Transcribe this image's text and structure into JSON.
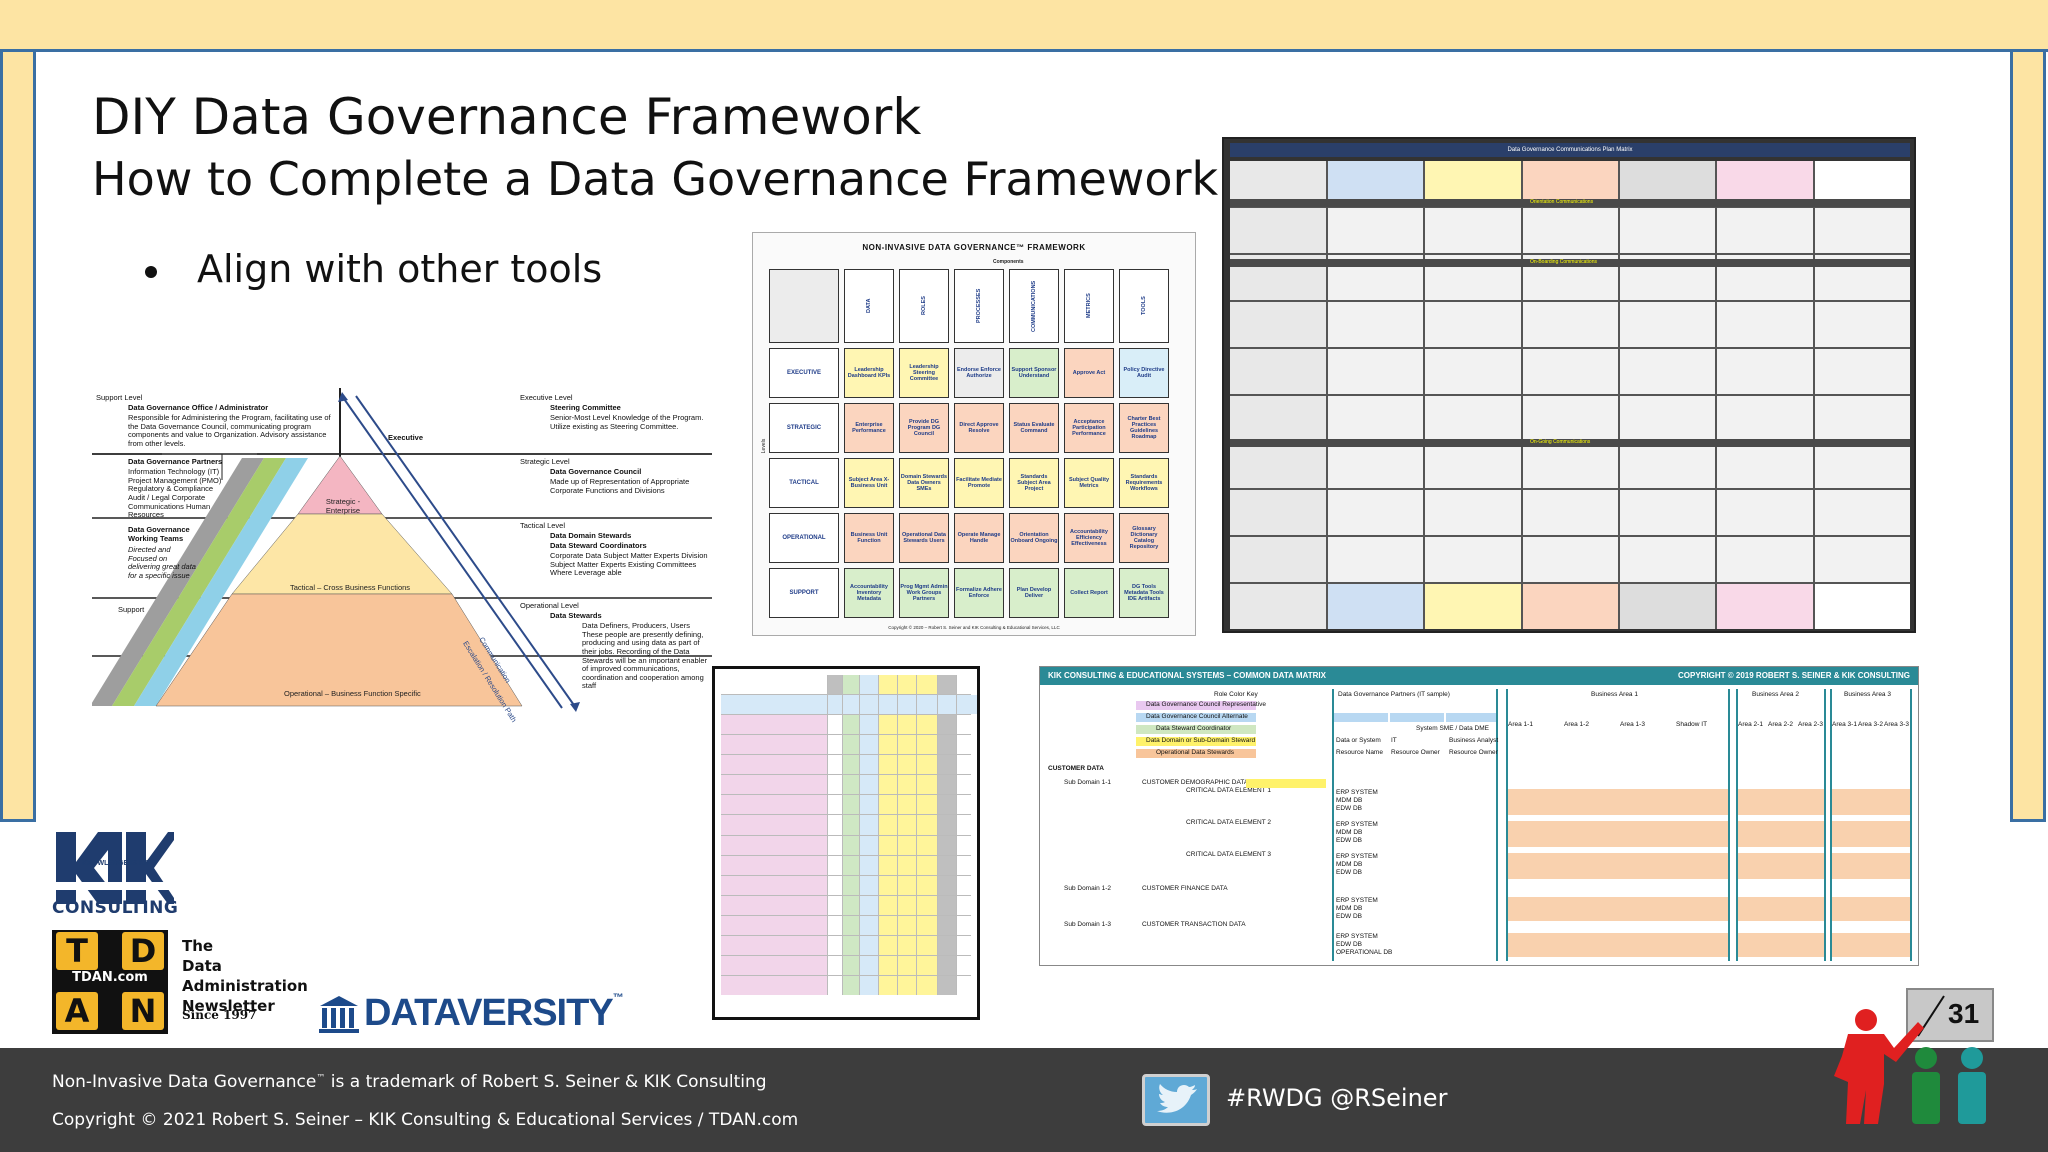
{
  "slide": {
    "title": "DIY Data Governance Framework",
    "subtitle": "How to Complete a Data Governance Framework",
    "bullet": "Align with other tools",
    "page_number": "31"
  },
  "pyramid": {
    "support_level": "Support Level",
    "dgo": "Data Governance Office / Administrator",
    "dgo_desc": "Responsible for Administering the Program, facilitating use of the Data Governance Council, communicating program components and value to Organization. Advisory assistance from other levels.",
    "partners": "Data Governance Partners",
    "partners_desc": "Information Technology (IT) Project Management (PMO) Regulatory & Compliance Audit / Legal Corporate Communications Human Resources",
    "working_teams": "Data Governance Working Teams",
    "working_desc": "Directed and Focused on delivering great data for a specific issue",
    "support": "Support",
    "executive": "Executive",
    "exec_level": "Executive Level",
    "steering": "Steering Committee",
    "steering_desc": "Senior-Most Level Knowledge of the Program. Utilize existing as Steering Committee.",
    "strategic_level": "Strategic Level",
    "council": "Data Governance Council",
    "council_desc": "Made up of Representation of Appropriate Corporate Functions and Divisions",
    "tactical_level": "Tactical Level",
    "domain": "Data Domain Stewards",
    "coord": "Data Steward Coordinators",
    "tactical_desc": "Corporate Data Subject Matter Experts Division Subject Matter Experts Existing Committees Where Leverage able",
    "operational_level": "Operational Level",
    "stewards": "Data Stewards",
    "stewards_desc": "Data Definers, Producers, Users These people are presently defining, producing and using data as part of their jobs. Recording of the Data Stewards will be an important enabler of improved communications, coordination and cooperation among staff",
    "strategic_band": "Strategic - Enterprise",
    "tactical_band": "Tactical – Cross Business Functions",
    "operational_band": "Operational – Business Function Specific",
    "comm_arrow": "Communication",
    "esc_arrow": "Escalation / Resolution Path"
  },
  "nidg": {
    "title": "NON-INVASIVE DATA GOVERNANCE™ FRAMEWORK",
    "components": "Components",
    "levels": "Levels",
    "columns": [
      "DATA",
      "ROLES",
      "PROCESSES",
      "COMMUNICATIONS",
      "METRICS",
      "TOOLS"
    ],
    "rows": [
      {
        "label": "EXECUTIVE",
        "cells": [
          "Leadership Dashboard KPIs",
          "Leadership Steering Committee",
          "Endorse Enforce Authorize",
          "Support Sponsor Understand",
          "Approve Act",
          "Policy Directive Audit"
        ]
      },
      {
        "label": "STRATEGIC",
        "cells": [
          "Enterprise Performance",
          "Provide DG Program DG Council",
          "Direct Approve Resolve",
          "Status Evaluate Command",
          "Acceptance Participation Performance",
          "Charter Best Practices Guidelines Roadmap"
        ]
      },
      {
        "label": "TACTICAL",
        "cells": [
          "Subject Area X-Business Unit",
          "Domain Stewards Data Owners SMEs",
          "Facilitate Mediate Promote",
          "Standards Subject Area Project",
          "Subject Quality Metrics",
          "Standards Requirements Workflows"
        ]
      },
      {
        "label": "OPERATIONAL",
        "cells": [
          "Business Unit Function",
          "Operational Data Stewards Users",
          "Operate Manage Handle",
          "Orientation Onboard Ongoing",
          "Accountability Efficiency Effectiveness",
          "Glossary Dictionary Catalog Repository"
        ]
      },
      {
        "label": "SUPPORT",
        "cells": [
          "Accountability Inventory Metadata",
          "Prog Mgmt Admin Work Groups Partners",
          "Formalize Adhere Enforce",
          "Plan Develop Deliver",
          "Collect Report",
          "DG Tools Metadata Tools IDE Artifacts"
        ]
      }
    ],
    "copyright": "Copyright © 2020 – Robert S. Seiner and KIK Consulting & Educational Services, LLC"
  },
  "comms": {
    "title": "Data Governance Communications Plan Matrix",
    "band1": "Orientation Communications",
    "band2": "On-Boarding Communications",
    "band3": "On-Going Communications"
  },
  "cdm": {
    "title_left": "KIK CONSULTING & EDUCATIONAL SYSTEMS – COMMON DATA MATRIX",
    "title_right": "COPYRIGHT © 2019 ROBERT S. SEINER & KIK CONSULTING",
    "role_key": "Role Color Key",
    "roles": [
      "Data Governance Council Representative",
      "Data Governance Council Alternate",
      "Data Steward Coordinator",
      "Data Domain or Sub-Domain Steward",
      "Operational Data Stewards"
    ],
    "partners": "Data Governance Partners (IT sample)",
    "ba1": "Business Area 1",
    "ba2": "Business Area 2",
    "ba3": "Business Area 3",
    "area_cols": [
      "Area 1-1",
      "Area 1-2",
      "Area 1-3",
      "Shadow IT",
      "Area 2-1",
      "Area 2-2",
      "Area 2-3",
      "Area 3-1",
      "Area 3-2",
      "Area 3-3"
    ],
    "sme": "System SME / Data DME",
    "ds": "Data or System",
    "it": "IT",
    "bus_analyst": "Business Analyst",
    "rn": "Resource Name",
    "ro1": "Resource Owner",
    "ro2": "Resource Owner",
    "customer_data": "CUSTOMER DATA",
    "sub1": "Sub Domain 1-1",
    "sub2": "Sub Domain 1-2",
    "sub3": "Sub Domain 1-3",
    "cust_demo": "CUSTOMER DEMOGRAPHIC DATA",
    "cust_fin": "CUSTOMER FINANCE DATA",
    "cust_trans": "CUSTOMER TRANSACTION DATA",
    "cde1": "CRITICAL DATA ELEMENT 1",
    "cde2": "CRITICAL DATA ELEMENT 2",
    "cde3": "CRITICAL DATA ELEMENT 3",
    "sys1": "ERP SYSTEM",
    "sys2": "MDM DB",
    "sys3": "EDW DB",
    "sys4": "OPERATIONAL DB"
  },
  "logos": {
    "kik_tagline": "KNOWLEDGE IS KING",
    "kik": "CONSULTING",
    "tdan_letters": [
      "T",
      "D",
      "A",
      "N"
    ],
    "tdan_mid": "TDAN.com",
    "tdan_words": [
      "The",
      "Data",
      "Administration",
      "Newsletter"
    ],
    "tdan_since": "Since 1997",
    "dataversity": "DATAVERSITY",
    "dataversity_tm": "™"
  },
  "footer": {
    "line1_pre": "Non-Invasive Data Governance",
    "line1_tm": "™",
    "line1_post": " is a trademark of Robert S. Seiner & KIK Consulting",
    "line2": "Copyright © 2021 Robert S. Seiner – KIK Consulting & Educational Services / TDAN.com",
    "twitter": "#RWDG @RSeiner"
  },
  "colors": {
    "frame": "#fde4a3",
    "frame_border": "#3a6fa3",
    "footer": "#3d3d3d",
    "pyramid_strategic": "#f4b6c2",
    "pyramid_tactical": "#fde6a6",
    "pyramid_operational": "#f8c59a"
  }
}
